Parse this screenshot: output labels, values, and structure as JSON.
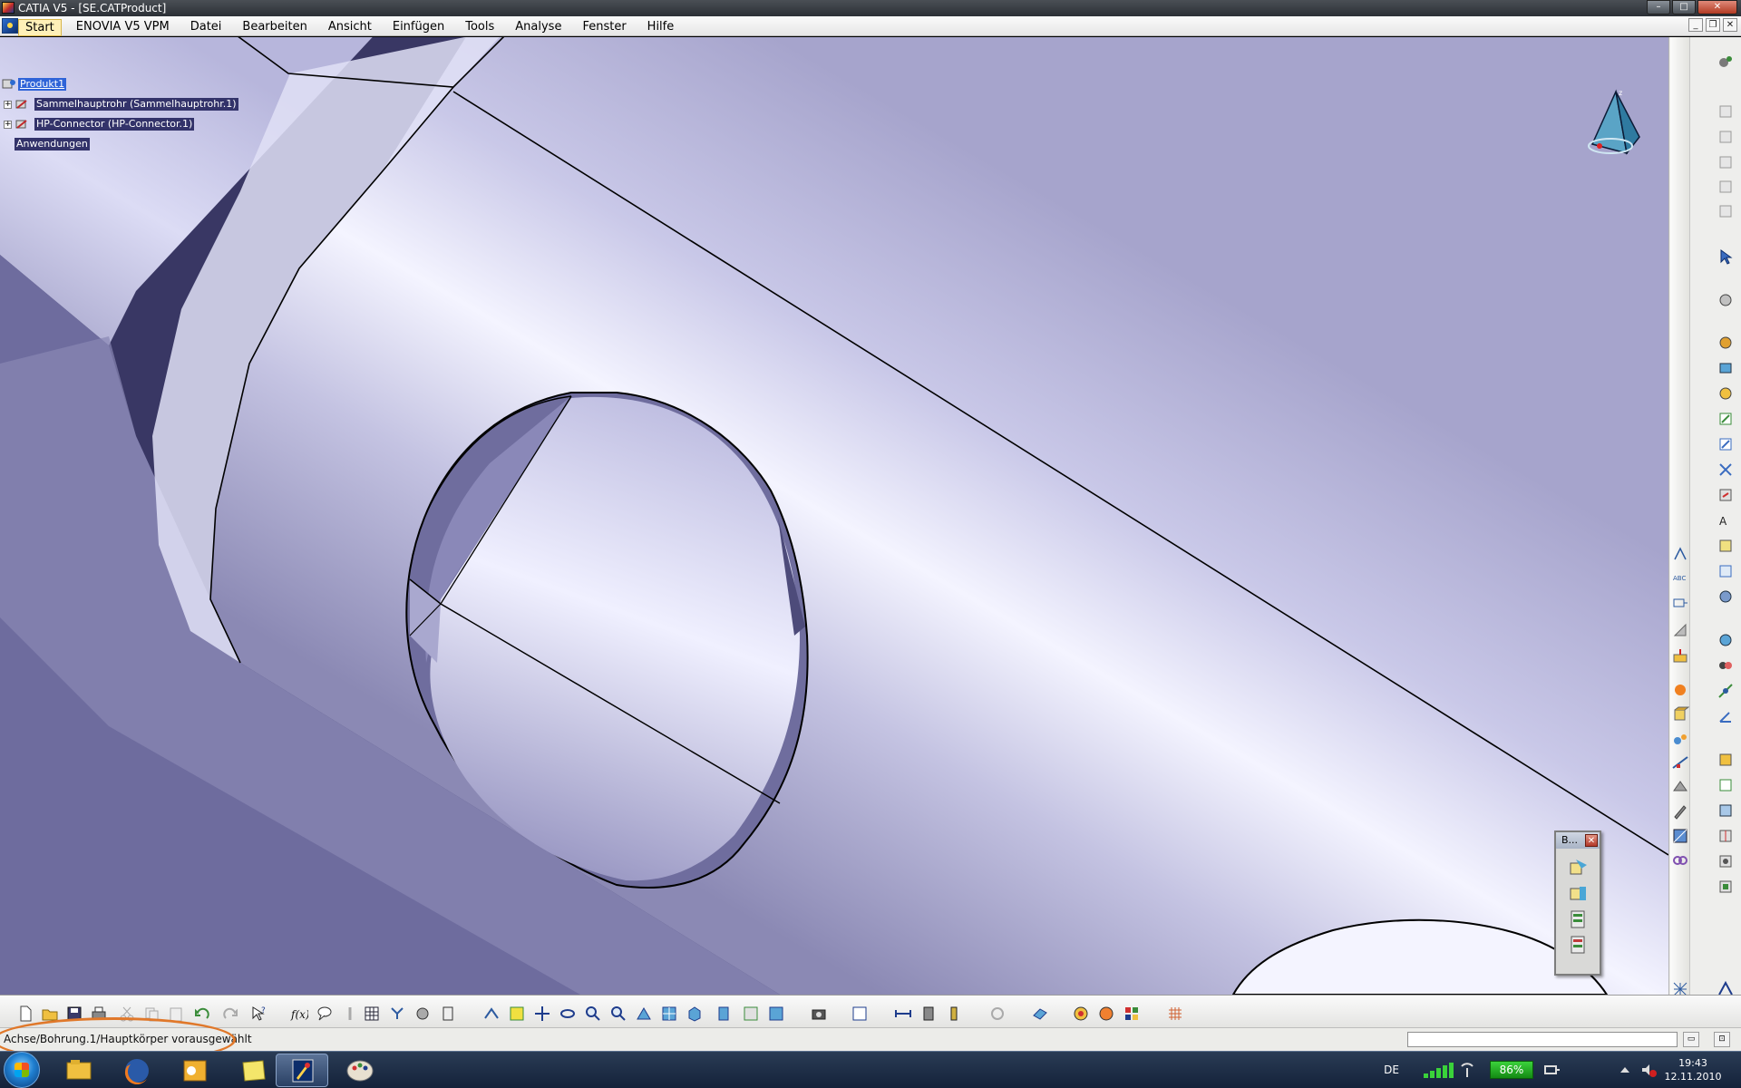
{
  "window": {
    "title": "CATIA V5 - [SE.CATProduct]"
  },
  "menu": {
    "items": [
      "Start",
      "ENOVIA V5 VPM",
      "Datei",
      "Bearbeiten",
      "Ansicht",
      "Einfügen",
      "Tools",
      "Analyse",
      "Fenster",
      "Hilfe"
    ],
    "active": "Start"
  },
  "tree": {
    "root": "Produkt1",
    "children": [
      "Sammelhauptrohr (Sammelhauptrohr.1)",
      "HP-Connector (HP-Connector.1)"
    ],
    "applications": "Anwendungen"
  },
  "floating_toolbar": {
    "title": "B..."
  },
  "status": {
    "message": "Achse/Bohrung.1/Hauptkörper vorausgewählt",
    "highlight_color": "#e0782a"
  },
  "taskbar": {
    "language": "DE",
    "battery": "86%",
    "time": "19:43",
    "date": "12.11.2010"
  },
  "colors": {
    "viewport_background": "#393764",
    "part_surface": "#d4d4ee"
  }
}
